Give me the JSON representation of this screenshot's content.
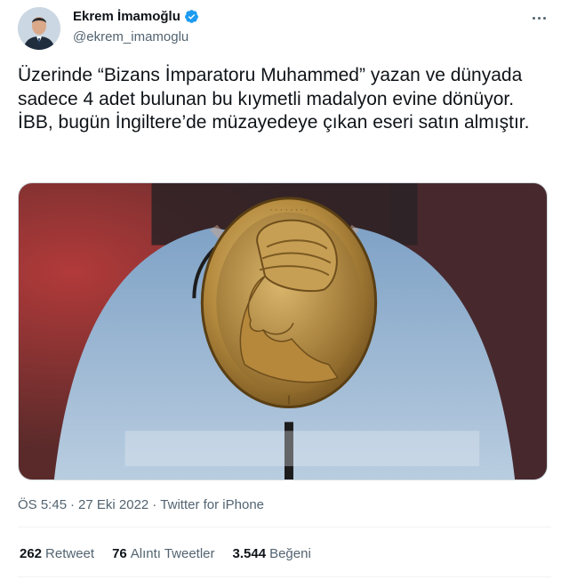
{
  "author": {
    "display_name": "Ekrem İmamoğlu",
    "handle": "@ekrem_imamoglu",
    "verified": true,
    "avatar_icon": "user-avatar",
    "verified_icon": "verified-badge-icon",
    "verified_color": "#1d9bf0"
  },
  "tweet": {
    "text": "Üzerinde “Bizans İmparatoru Muhammed” yazan ve dünyada sadece 4 adet bulunan bu kıymetli madalyon evine dönüyor. İBB, bugün İngiltere’de müzayedeye çıkan eseri satın almıştır.",
    "media_description_icon": "medallion-photo"
  },
  "meta": {
    "time": "ÖS 5:45",
    "sep1": "·",
    "date": "27 Eki 2022",
    "sep2": "·",
    "source": "Twitter for iPhone"
  },
  "stats": [
    {
      "count": "262",
      "label": "Retweet"
    },
    {
      "count": "76",
      "label": "Alıntı Tweetler"
    },
    {
      "count": "3.544",
      "label": "Beğeni"
    }
  ],
  "colors": {
    "text_primary": "#0f1419",
    "text_secondary": "#536471",
    "divider": "#eff3f4"
  }
}
